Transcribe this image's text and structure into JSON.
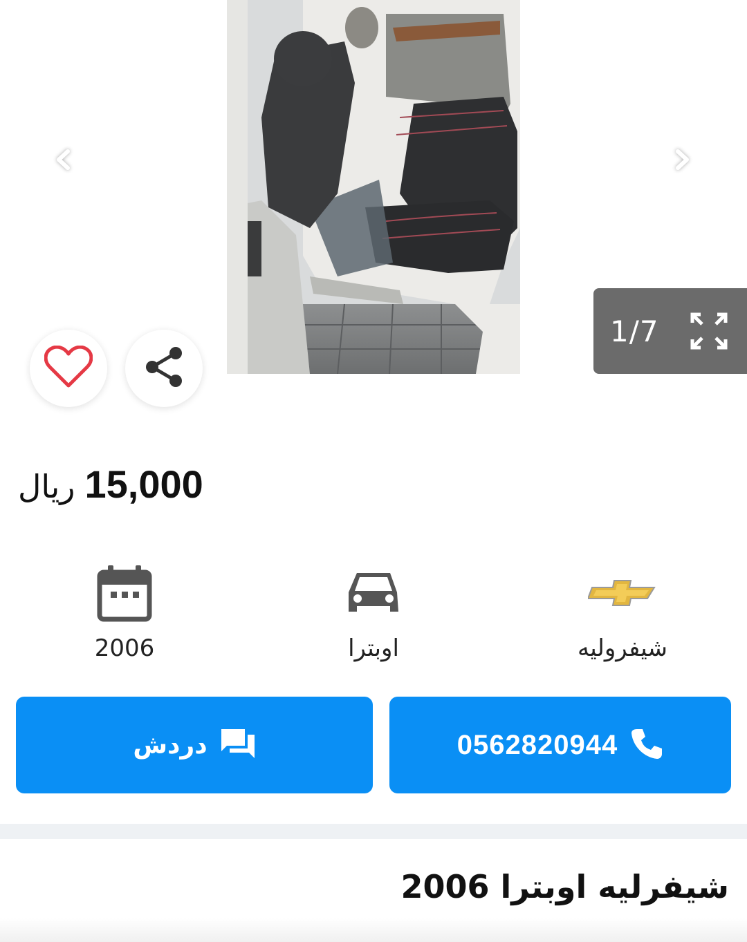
{
  "gallery": {
    "counter": "1/7",
    "prev_icon": "chevron-left-icon",
    "next_icon": "chevron-right-icon",
    "expand_icon": "fullscreen-icon",
    "photo": "car-rear-seat-interior-photo"
  },
  "actions": {
    "favorite_icon": "heart-icon",
    "share_icon": "share-icon"
  },
  "price": {
    "amount": "15,000",
    "currency": "ريال"
  },
  "specs": {
    "year": {
      "icon": "calendar-icon",
      "label": "2006"
    },
    "model": {
      "icon": "car-icon",
      "label": "اوبترا"
    },
    "make": {
      "icon": "chevrolet-logo-icon",
      "label": "شيفروليه"
    }
  },
  "buttons": {
    "chat": {
      "label": "دردش",
      "icon": "chat-icon"
    },
    "call": {
      "label": "0562820944",
      "icon": "phone-icon"
    }
  },
  "colors": {
    "accent": "#0a8ff5",
    "favorite": "#e53945",
    "counter_bg": "#6b6b6b"
  },
  "listing": {
    "title": "شيفرليه اوبترا 2006"
  }
}
